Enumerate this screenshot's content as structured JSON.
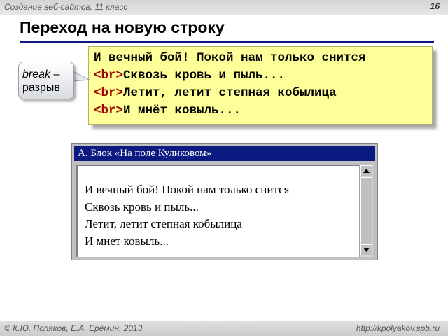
{
  "header": {
    "course": "Создание веб-сайтов, 11 класс",
    "slide_number": "16"
  },
  "slide": {
    "title": "Переход на новую строку"
  },
  "code": {
    "line1": "И вечный бой! Покой нам только снится",
    "tag": "<br>",
    "line2": "Сквозь кровь и пыль...",
    "line3": "Летит, летит степная кобылица",
    "line4": "И мнёт ковыль..."
  },
  "callout": {
    "term": "break",
    "dash": " –",
    "meaning": "разрыв"
  },
  "browser": {
    "title": "А. Блок «На поле Куликовом»",
    "lines": [
      "И вечный бой! Покой нам только снится",
      "Сквозь кровь и пыль...",
      "Летит, летит степная кобылица",
      "И мнет ковыль..."
    ]
  },
  "footer": {
    "authors": "© К.Ю. Поляков, Е.А. Ерёмин, 2013",
    "url": "http://kpolyakov.spb.ru"
  },
  "colors": {
    "title_bar": "#0a1a80",
    "code_background": "#ffff99",
    "tag_color": "#a00000"
  }
}
